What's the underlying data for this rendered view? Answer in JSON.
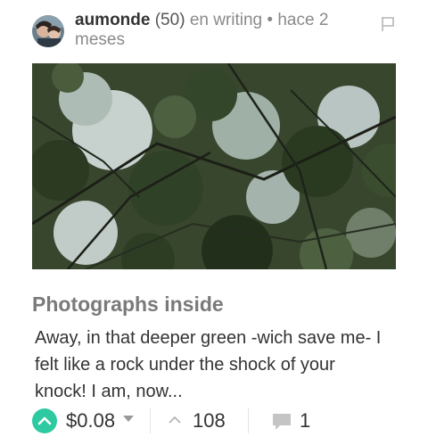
{
  "post": {
    "author": "aumonde",
    "reputation": "(50)",
    "category_text": "en writing",
    "separator": "•",
    "time_ago": "hace 2 meses",
    "title": "Photographs inside",
    "excerpt": "Away, in that deeper green -wich save me- I felt like a rock under the shock of your knock! I am, now...",
    "payout": "$0.08",
    "votes": "108",
    "comments": "1"
  },
  "icons": {
    "flag": "flag-icon",
    "upvote": "upvote-chevron-icon",
    "dropdown": "caret-down-icon",
    "votes": "chevron-up-icon",
    "comments": "speech-bubble-icon"
  },
  "colors": {
    "accent": "#2dc9a0",
    "title": "#7a7a7a",
    "muted": "#8a8a8a"
  }
}
